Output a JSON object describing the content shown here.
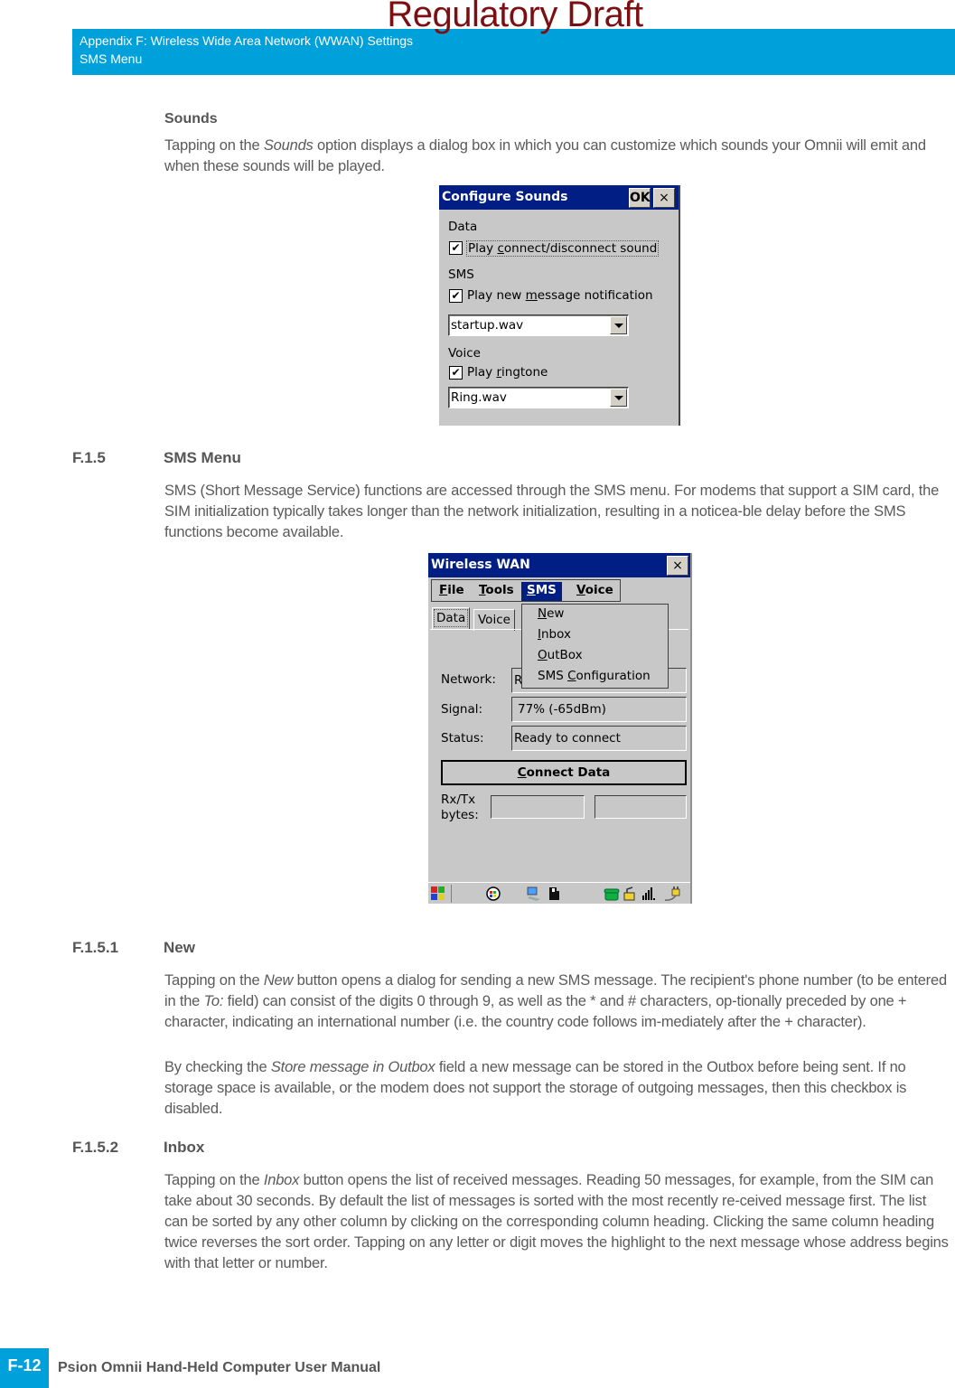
{
  "watermark": "Regulatory Draft",
  "header": {
    "line1": "Appendix F: Wireless Wide Area Network (WWAN) Settings",
    "line2": "SMS Menu"
  },
  "sounds": {
    "heading": "Sounds",
    "para_pre": "Tapping on the ",
    "para_em": "Sounds",
    "para_post": " option displays a dialog box in which you can customize which sounds your Omnii will emit and when these sounds will be played."
  },
  "configure_sounds_dialog": {
    "title": "Configure Sounds",
    "ok_label": "OK",
    "close_label": "×",
    "data_group": "Data",
    "data_checkbox": {
      "pre": "Play ",
      "u": "c",
      "post": "onnect/disconnect sound",
      "checked": true
    },
    "sms_group": "SMS",
    "sms_checkbox": {
      "pre": "Play new ",
      "u": "m",
      "post": "essage notification",
      "checked": true
    },
    "sms_sound": "startup.wav",
    "voice_group": "Voice",
    "voice_checkbox": {
      "pre": "Play ",
      "u": "r",
      "post": "ingtone",
      "checked": true
    },
    "voice_sound": "Ring.wav",
    "check_glyph": "✔"
  },
  "section_f15": {
    "number": "F.1.5",
    "title": "SMS Menu",
    "para": "SMS (Short Message Service) functions are accessed through the SMS menu. For modems that support a SIM card, the SIM initialization typically takes longer than the network initialization, resulting in a noticea-ble delay before the SMS functions become available."
  },
  "wwan_window": {
    "title": "Wireless WAN",
    "close_label": "×",
    "menu": [
      {
        "u": "F",
        "rest": "ile"
      },
      {
        "u": "T",
        "rest": "ools"
      },
      {
        "u": "S",
        "rest": "MS"
      },
      {
        "u": "V",
        "rest": "oice"
      }
    ],
    "sms_dropdown": [
      {
        "pre": "",
        "u": "N",
        "post": "ew"
      },
      {
        "pre": "",
        "u": "I",
        "post": "nbox"
      },
      {
        "pre": "",
        "u": "O",
        "post": "utBox"
      },
      {
        "pre": "SMS ",
        "u": "C",
        "post": "onfiguration"
      }
    ],
    "tabs": [
      "Data",
      "Voice"
    ],
    "network_label": "Network:",
    "network_value": "R",
    "signal_label": "Signal:",
    "signal_value": "77% (-65dBm)",
    "status_label": "Status:",
    "status_value": "Ready to connect",
    "connect_button": {
      "u": "C",
      "rest": "onnect Data"
    },
    "rxtx_label_1": "Rx/Tx",
    "rxtx_label_2": "bytes:",
    "rx_value": "",
    "tx_value": ""
  },
  "section_f151": {
    "number": "F.1.5.1",
    "title": "New",
    "p1_a": "Tapping on the ",
    "p1_em1": "New",
    "p1_b": " button opens a dialog for sending a new SMS message. The recipient's phone number (to be entered in the ",
    "p1_em2": "To:",
    "p1_c": " field) can consist of the digits 0 through 9, as well as the * and # characters, op-tionally preceded by one + character, indicating an international number (i.e. the country code follows im-mediately after the + character).",
    "p2_a": "By checking the ",
    "p2_em": "Store message in Outbox",
    "p2_b": " field a new message can be stored in the Outbox before being sent. If no storage space is available, or the modem does not support the storage of outgoing messages, then this checkbox is disabled."
  },
  "section_f152": {
    "number": "F.1.5.2",
    "title": "Inbox",
    "p_a": "Tapping on the ",
    "p_em": "Inbox",
    "p_b": " button opens the list of received messages. Reading 50 messages, for example, from the SIM can take about 30 seconds. By default the list of messages is sorted with the most recently re-ceived message first. The list can be sorted by any other column by clicking on the corresponding column heading. Clicking the same column heading twice reverses the sort order. Tapping on any letter or digit moves the highlight to the next message whose address begins with that letter or number."
  },
  "footer": {
    "page": "F-12",
    "title": "Psion Omnii Hand-Held Computer User Manual"
  },
  "colors": {
    "header_blue": "#00a0da",
    "watermark_red": "#7b0f12",
    "titlebar_navy": "#001e84"
  }
}
